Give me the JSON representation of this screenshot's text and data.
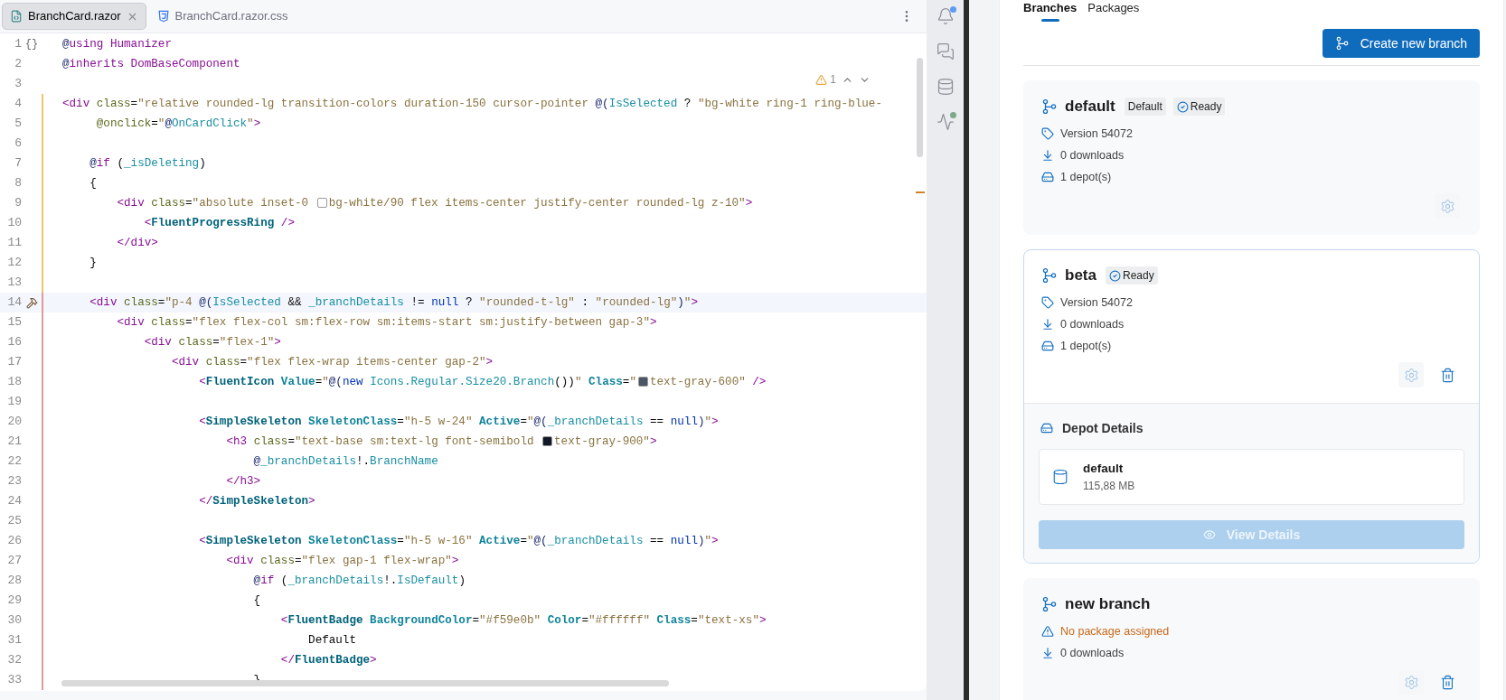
{
  "editor": {
    "tabs": [
      {
        "label": "BranchCard.razor",
        "selected": true,
        "kind": "razor",
        "closable": true
      },
      {
        "label": "BranchCard.razor.css",
        "selected": false,
        "kind": "css",
        "closable": false
      }
    ],
    "inspection": {
      "count": "1"
    },
    "lines": [
      {
        "number": "1",
        "current": false,
        "gutter": "{}",
        "tokens": [
          {
            "kind": "at",
            "text": "@"
          },
          {
            "kind": "kw",
            "text": "using "
          },
          {
            "kind": "type",
            "text": "Humanizer"
          }
        ]
      },
      {
        "number": "2",
        "current": false,
        "tokens": [
          {
            "kind": "at",
            "text": "@"
          },
          {
            "kind": "kw",
            "text": "inherits "
          },
          {
            "kind": "type",
            "text": "DomBaseComponent"
          }
        ]
      },
      {
        "number": "3",
        "current": false
      },
      {
        "number": "4",
        "kind": "modified",
        "current": false,
        "tokens": [
          {
            "kind": "tag",
            "text": "<div "
          },
          {
            "kind": "attr",
            "text": "class"
          },
          {
            "kind": "plain",
            "text": "="
          },
          {
            "kind": "str",
            "text": "\"relative rounded-lg transition-colors duration-150 cursor-pointer "
          },
          {
            "kind": "at",
            "text": "@("
          },
          {
            "kind": "ident",
            "text": "IsSelected"
          },
          {
            "kind": "plain",
            "text": " ? "
          },
          {
            "kind": "str",
            "text": "\"bg-white ring-1 ring-blue-"
          }
        ]
      },
      {
        "number": "5",
        "kind": "modified",
        "current": false,
        "tokens": [
          {
            "kind": "attr",
            "text": "     @onclick"
          },
          {
            "kind": "plain",
            "text": "="
          },
          {
            "kind": "str",
            "text": "\""
          },
          {
            "kind": "at",
            "text": "@"
          },
          {
            "kind": "ident",
            "text": "OnCardClick"
          },
          {
            "kind": "str",
            "text": "\""
          },
          {
            "kind": "tag",
            "text": ">"
          }
        ]
      },
      {
        "number": "6",
        "kind": "modified",
        "current": false
      },
      {
        "number": "7",
        "kind": "modified",
        "current": false,
        "tokens": [
          {
            "kind": "at",
            "text": "    @"
          },
          {
            "kind": "kw",
            "text": "if"
          },
          {
            "kind": "plain",
            "text": " ("
          },
          {
            "kind": "ident",
            "text": "_isDeleting"
          },
          {
            "kind": "plain",
            "text": ")"
          }
        ]
      },
      {
        "number": "8",
        "kind": "modified",
        "current": false,
        "tokens": [
          {
            "kind": "plain",
            "text": "    {"
          }
        ]
      },
      {
        "number": "9",
        "kind": "modified",
        "current": false,
        "tokens": [
          {
            "kind": "tag",
            "text": "        <div "
          },
          {
            "kind": "attr",
            "text": "class"
          },
          {
            "kind": "plain",
            "text": "="
          },
          {
            "kind": "str",
            "text": "\"absolute inset-0 "
          },
          {
            "kind": "swatch",
            "color": "#ffffff"
          },
          {
            "kind": "str",
            "text": "bg-white/90 flex items-center justify-center rounded-lg z-10\""
          },
          {
            "kind": "tag",
            "text": ">"
          }
        ]
      },
      {
        "number": "10",
        "kind": "modified",
        "current": false,
        "tokens": [
          {
            "kind": "tag",
            "text": "            <"
          },
          {
            "kind": "comp",
            "text": "FluentProgressRing "
          },
          {
            "kind": "tag",
            "text": "/>"
          }
        ]
      },
      {
        "number": "11",
        "kind": "modified",
        "current": false,
        "tokens": [
          {
            "kind": "tag",
            "text": "        </div>"
          }
        ]
      },
      {
        "number": "12",
        "kind": "modified",
        "current": false,
        "tokens": [
          {
            "kind": "plain",
            "text": "    }"
          }
        ]
      },
      {
        "number": "13",
        "kind": "modified",
        "current": false
      },
      {
        "number": "14",
        "kind": "error",
        "current": true,
        "gutter_icon": {
          "kind": "hammer"
        },
        "tokens": [
          {
            "kind": "tag",
            "text": "    <div "
          },
          {
            "kind": "attr",
            "text": "class"
          },
          {
            "kind": "plain",
            "text": "="
          },
          {
            "kind": "str",
            "text": "\"p-4 "
          },
          {
            "kind": "at",
            "text": "@("
          },
          {
            "kind": "ident",
            "text": "IsSelected"
          },
          {
            "kind": "plain",
            "text": " && "
          },
          {
            "kind": "ident",
            "text": "_branchDetails"
          },
          {
            "kind": "plain",
            "text": " != "
          },
          {
            "kind": "keyword",
            "text": "null"
          },
          {
            "kind": "plain",
            "text": " ? "
          },
          {
            "kind": "str",
            "text": "\"rounded-t-lg\""
          },
          {
            "kind": "plain",
            "text": " : "
          },
          {
            "kind": "str",
            "text": "\"rounded-lg\""
          },
          {
            "kind": "at",
            "text": ")"
          },
          {
            "kind": "str",
            "text": "\""
          },
          {
            "kind": "tag",
            "text": ">"
          }
        ]
      },
      {
        "number": "15",
        "kind": "error",
        "current": false,
        "tokens": [
          {
            "kind": "tag",
            "text": "        <div "
          },
          {
            "kind": "attr",
            "text": "class"
          },
          {
            "kind": "plain",
            "text": "="
          },
          {
            "kind": "str",
            "text": "\"flex flex-col sm:flex-row sm:items-start sm:justify-between gap-3\""
          },
          {
            "kind": "tag",
            "text": ">"
          }
        ]
      },
      {
        "number": "16",
        "kind": "error",
        "current": false,
        "tokens": [
          {
            "kind": "tag",
            "text": "            <div "
          },
          {
            "kind": "attr",
            "text": "class"
          },
          {
            "kind": "plain",
            "text": "="
          },
          {
            "kind": "str",
            "text": "\"flex-1\""
          },
          {
            "kind": "tag",
            "text": ">"
          }
        ]
      },
      {
        "number": "17",
        "kind": "error",
        "current": false,
        "tokens": [
          {
            "kind": "tag",
            "text": "                <div "
          },
          {
            "kind": "attr",
            "text": "class"
          },
          {
            "kind": "plain",
            "text": "="
          },
          {
            "kind": "str",
            "text": "\"flex flex-wrap items-center gap-2\""
          },
          {
            "kind": "tag",
            "text": ">"
          }
        ]
      },
      {
        "number": "18",
        "kind": "error",
        "current": false,
        "tokens": [
          {
            "kind": "tag",
            "text": "                    <"
          },
          {
            "kind": "comp",
            "text": "FluentIcon "
          },
          {
            "kind": "cattr",
            "text": "Value"
          },
          {
            "kind": "plain",
            "text": "="
          },
          {
            "kind": "str",
            "text": "\""
          },
          {
            "kind": "at",
            "text": "@("
          },
          {
            "kind": "keyword",
            "text": "new "
          },
          {
            "kind": "ident",
            "text": "Icons.Regular.Size20.Branch"
          },
          {
            "kind": "plain",
            "text": "())"
          },
          {
            "kind": "str",
            "text": "\" "
          },
          {
            "kind": "cattr",
            "text": "Class"
          },
          {
            "kind": "plain",
            "text": "="
          },
          {
            "kind": "str",
            "text": "\""
          },
          {
            "kind": "swatch",
            "color": "#4b5563"
          },
          {
            "kind": "str",
            "text": "text-gray-600\" "
          },
          {
            "kind": "tag",
            "text": "/>"
          }
        ]
      },
      {
        "number": "19",
        "kind": "error",
        "current": false
      },
      {
        "number": "20",
        "kind": "error",
        "current": false,
        "tokens": [
          {
            "kind": "tag",
            "text": "                    <"
          },
          {
            "kind": "comp",
            "text": "SimpleSkeleton "
          },
          {
            "kind": "cattr",
            "text": "SkeletonClass"
          },
          {
            "kind": "plain",
            "text": "="
          },
          {
            "kind": "str",
            "text": "\"h-5 w-24\" "
          },
          {
            "kind": "cattr",
            "text": "Active"
          },
          {
            "kind": "plain",
            "text": "="
          },
          {
            "kind": "str",
            "text": "\""
          },
          {
            "kind": "at",
            "text": "@("
          },
          {
            "kind": "ident",
            "text": "_branchDetails"
          },
          {
            "kind": "plain",
            "text": " == "
          },
          {
            "kind": "keyword",
            "text": "null"
          },
          {
            "kind": "at",
            "text": ")"
          },
          {
            "kind": "str",
            "text": "\""
          },
          {
            "kind": "tag",
            "text": ">"
          }
        ]
      },
      {
        "number": "21",
        "kind": "error",
        "current": false,
        "tokens": [
          {
            "kind": "tag",
            "text": "                        <h3 "
          },
          {
            "kind": "attr",
            "text": "class"
          },
          {
            "kind": "plain",
            "text": "="
          },
          {
            "kind": "str",
            "text": "\"text-base sm:text-lg font-semibold "
          },
          {
            "kind": "swatch",
            "color": "#111827"
          },
          {
            "kind": "str",
            "text": "text-gray-900\""
          },
          {
            "kind": "tag",
            "text": ">"
          }
        ]
      },
      {
        "number": "22",
        "kind": "error",
        "current": false,
        "tokens": [
          {
            "kind": "at",
            "text": "                            @"
          },
          {
            "kind": "ident",
            "text": "_branchDetails"
          },
          {
            "kind": "plain",
            "text": "!."
          },
          {
            "kind": "ident",
            "text": "BranchName"
          }
        ]
      },
      {
        "number": "23",
        "kind": "error",
        "current": false,
        "tokens": [
          {
            "kind": "tag",
            "text": "                        </h3>"
          }
        ]
      },
      {
        "number": "24",
        "kind": "error",
        "current": false,
        "tokens": [
          {
            "kind": "tag",
            "text": "                    </"
          },
          {
            "kind": "comp",
            "text": "SimpleSkeleton"
          },
          {
            "kind": "tag",
            "text": ">"
          }
        ]
      },
      {
        "number": "25",
        "kind": "error",
        "current": false
      },
      {
        "number": "26",
        "kind": "error",
        "current": false,
        "tokens": [
          {
            "kind": "tag",
            "text": "                    <"
          },
          {
            "kind": "comp",
            "text": "SimpleSkeleton "
          },
          {
            "kind": "cattr",
            "text": "SkeletonClass"
          },
          {
            "kind": "plain",
            "text": "="
          },
          {
            "kind": "str",
            "text": "\"h-5 w-16\" "
          },
          {
            "kind": "cattr",
            "text": "Active"
          },
          {
            "kind": "plain",
            "text": "="
          },
          {
            "kind": "str",
            "text": "\""
          },
          {
            "kind": "at",
            "text": "@("
          },
          {
            "kind": "ident",
            "text": "_branchDetails"
          },
          {
            "kind": "plain",
            "text": " == "
          },
          {
            "kind": "keyword",
            "text": "null"
          },
          {
            "kind": "at",
            "text": ")"
          },
          {
            "kind": "str",
            "text": "\""
          },
          {
            "kind": "tag",
            "text": ">"
          }
        ]
      },
      {
        "number": "27",
        "kind": "error",
        "current": false,
        "tokens": [
          {
            "kind": "tag",
            "text": "                        <div "
          },
          {
            "kind": "attr",
            "text": "class"
          },
          {
            "kind": "plain",
            "text": "="
          },
          {
            "kind": "str",
            "text": "\"flex gap-1 flex-wrap\""
          },
          {
            "kind": "tag",
            "text": ">"
          }
        ]
      },
      {
        "number": "28",
        "kind": "error",
        "current": false,
        "tokens": [
          {
            "kind": "at",
            "text": "                            @"
          },
          {
            "kind": "kw",
            "text": "if"
          },
          {
            "kind": "plain",
            "text": " ("
          },
          {
            "kind": "ident",
            "text": "_branchDetails"
          },
          {
            "kind": "plain",
            "text": "!."
          },
          {
            "kind": "ident",
            "text": "IsDefault"
          },
          {
            "kind": "plain",
            "text": ")"
          }
        ]
      },
      {
        "number": "29",
        "kind": "error",
        "current": false,
        "tokens": [
          {
            "kind": "plain",
            "text": "                            {"
          }
        ]
      },
      {
        "number": "30",
        "kind": "error",
        "current": false,
        "tokens": [
          {
            "kind": "tag",
            "text": "                                <"
          },
          {
            "kind": "comp",
            "text": "FluentBadge "
          },
          {
            "kind": "cattr",
            "text": "BackgroundColor"
          },
          {
            "kind": "plain",
            "text": "="
          },
          {
            "kind": "str",
            "text": "\"#f59e0b\" "
          },
          {
            "kind": "cattr",
            "text": "Color"
          },
          {
            "kind": "plain",
            "text": "="
          },
          {
            "kind": "str",
            "text": "\"#ffffff\" "
          },
          {
            "kind": "cattr",
            "text": "Class"
          },
          {
            "kind": "plain",
            "text": "="
          },
          {
            "kind": "str",
            "text": "\"text-xs\""
          },
          {
            "kind": "tag",
            "text": ">"
          }
        ]
      },
      {
        "number": "31",
        "kind": "error",
        "current": false,
        "tokens": [
          {
            "kind": "plain",
            "text": "                                    Default"
          }
        ]
      },
      {
        "number": "32",
        "kind": "error",
        "current": false,
        "tokens": [
          {
            "kind": "tag",
            "text": "                                </"
          },
          {
            "kind": "comp",
            "text": "FluentBadge"
          },
          {
            "kind": "tag",
            "text": ">"
          }
        ]
      },
      {
        "number": "33",
        "kind": "error",
        "current": false,
        "tokens": [
          {
            "kind": "plain",
            "text": "                            }"
          }
        ]
      }
    ]
  },
  "tool_strip": [
    {
      "kind": "notifications",
      "color": "#5c9cf5"
    },
    {
      "kind": "chat"
    },
    {
      "kind": "database"
    },
    {
      "kind": "activity",
      "color": "#7ea88a"
    }
  ],
  "panel": {
    "tabs": [
      {
        "label": "Branches",
        "selected": true
      },
      {
        "label": "Packages",
        "selected": false
      }
    ],
    "create_button": {
      "label": "Create new branch"
    },
    "cards": [
      {
        "name": "default",
        "selected": false,
        "badges": [
          {
            "kind": "plain",
            "label": "Default"
          },
          {
            "kind": "status",
            "label": "Ready"
          }
        ],
        "meta": [
          {
            "kind": "version",
            "text": "Version 54072"
          },
          {
            "kind": "downloads",
            "text": "0 downloads"
          },
          {
            "kind": "depots",
            "text": "1 depot(s)"
          }
        ],
        "actions": [
          {
            "kind": "settings"
          }
        ]
      },
      {
        "name": "beta",
        "selected": true,
        "badges": [
          {
            "kind": "status",
            "label": "Ready"
          }
        ],
        "meta": [
          {
            "kind": "version",
            "text": "Version 54072"
          },
          {
            "kind": "downloads",
            "text": "0 downloads"
          },
          {
            "kind": "depots",
            "text": "1 depot(s)"
          }
        ],
        "actions": [
          {
            "kind": "settings"
          },
          {
            "kind": "delete"
          }
        ],
        "details": {
          "title": "Depot Details",
          "depots": [
            {
              "name": "default",
              "size": "115,88 MB"
            }
          ],
          "button": {
            "label": "View Details",
            "disabled": true
          }
        }
      },
      {
        "name": "new branch",
        "selected": false,
        "meta": [
          {
            "kind": "warning",
            "text": "No package assigned"
          },
          {
            "kind": "downloads",
            "text": "0 downloads"
          }
        ],
        "actions": [
          {
            "kind": "settings"
          },
          {
            "kind": "delete"
          }
        ]
      }
    ]
  }
}
